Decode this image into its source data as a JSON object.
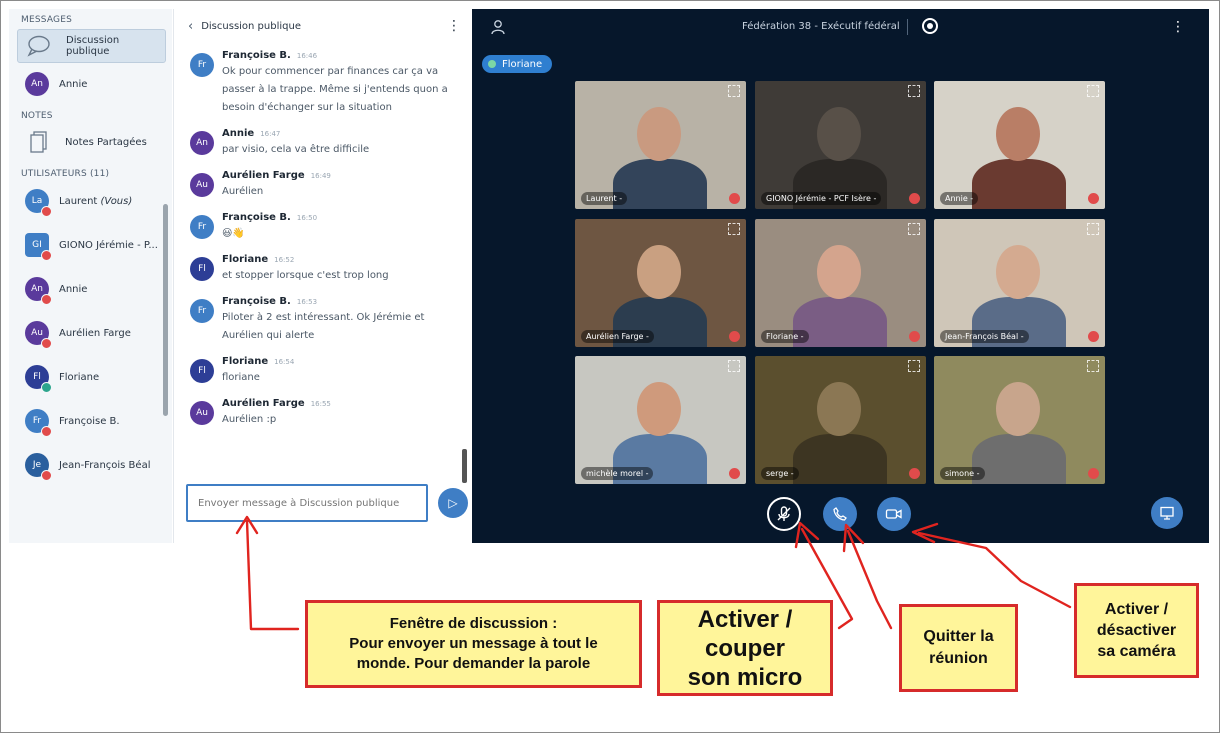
{
  "sidebar": {
    "messages_title": "MESSAGES",
    "public_chat": "Discussion publique",
    "private_chat": {
      "initials": "An",
      "name": "Annie",
      "color": "#5a3a9c"
    },
    "notes_title": "NOTES",
    "shared_notes": "Notes Partagées",
    "users_title": "UTILISATEURS (11)",
    "users": [
      {
        "initials": "La",
        "name": "Laurent",
        "suffix": "(Vous)",
        "color": "#3f7ec5",
        "mic": "muted",
        "shape": "round"
      },
      {
        "initials": "GI",
        "name": "GIONO Jérémie - P...",
        "suffix": "",
        "color": "#3f7ec5",
        "mic": "muted",
        "shape": "square"
      },
      {
        "initials": "An",
        "name": "Annie",
        "suffix": "",
        "color": "#5a3a9c",
        "mic": "muted",
        "shape": "round"
      },
      {
        "initials": "Au",
        "name": "Aurélien Farge",
        "suffix": "",
        "color": "#5a3a9c",
        "mic": "muted",
        "shape": "round"
      },
      {
        "initials": "Fl",
        "name": "Floriane",
        "suffix": "",
        "color": "#2d3e96",
        "mic": "on",
        "shape": "round"
      },
      {
        "initials": "Fr",
        "name": "Françoise B.",
        "suffix": "",
        "color": "#3f7ec5",
        "mic": "muted",
        "shape": "round"
      },
      {
        "initials": "Je",
        "name": "Jean-François Béal",
        "suffix": "",
        "color": "#2a5f9e",
        "mic": "muted",
        "shape": "round"
      }
    ]
  },
  "chat": {
    "title": "Discussion publique",
    "messages": [
      {
        "initials": "Fr",
        "color": "#3f7ec5",
        "author": "Françoise B.",
        "time": "16:46",
        "lines": [
          "Ok pour commencer par finances car ça va",
          "passer à la trappe. Même si j'entends quon a",
          "besoin d'échanger sur la situation"
        ]
      },
      {
        "initials": "An",
        "color": "#5a3a9c",
        "author": "Annie",
        "time": "16:47",
        "lines": [
          "par visio, cela va être difficile"
        ]
      },
      {
        "initials": "Au",
        "color": "#5a3a9c",
        "author": "Aurélien Farge",
        "time": "16:49",
        "lines": [
          "Aurélien"
        ]
      },
      {
        "initials": "Fr",
        "color": "#3f7ec5",
        "author": "Françoise B.",
        "time": "16:50",
        "lines": [
          "😃👋"
        ]
      },
      {
        "initials": "Fl",
        "color": "#2d3e96",
        "author": "Floriane",
        "time": "16:52",
        "lines": [
          "et stopper lorsque c'est trop long"
        ]
      },
      {
        "initials": "Fr",
        "color": "#3f7ec5",
        "author": "Françoise B.",
        "time": "16:53",
        "lines": [
          "Piloter à 2 est intéressant. Ok Jérémie et",
          "Aurélien qui alerte"
        ]
      },
      {
        "initials": "Fl",
        "color": "#2d3e96",
        "author": "Floriane",
        "time": "16:54",
        "lines": [
          "floriane"
        ]
      },
      {
        "initials": "Au",
        "color": "#5a3a9c",
        "author": "Aurélien Farge",
        "time": "16:55",
        "lines": [
          "Aurélien :p"
        ]
      }
    ],
    "input_placeholder": "Envoyer message à Discussion publique"
  },
  "meeting": {
    "title": "Fédération 38 - Exécutif fédéral",
    "talking": "Floriane",
    "tiles": [
      {
        "label": "Laurent -",
        "bg": "#b8b2a6",
        "skin": "#c99a80",
        "shirt": "#33445a"
      },
      {
        "label": "GIONO Jérémie - PCF Isère -",
        "bg": "#3f3b37",
        "skin": "#585048",
        "shirt": "#2b2825"
      },
      {
        "label": "Annie -",
        "bg": "#d6d2c8",
        "skin": "#b97e66",
        "shirt": "#6a3a30"
      },
      {
        "label": "Aurélien Farge -",
        "bg": "#6e5642",
        "skin": "#c9a081",
        "shirt": "#2c3d4f"
      },
      {
        "label": "Floriane -",
        "bg": "#9a8d80",
        "skin": "#d4a48d",
        "shirt": "#7a5d84"
      },
      {
        "label": "Jean-François Béal -",
        "bg": "#cfc6b8",
        "skin": "#d4aa90",
        "shirt": "#5a6c88"
      },
      {
        "label": "michèle morel -",
        "bg": "#c7c7c1",
        "skin": "#cf9a7c",
        "shirt": "#5a7aa2"
      },
      {
        "label": "serge -",
        "bg": "#5b4f2e",
        "skin": "#8b7754",
        "shirt": "#3d3522"
      },
      {
        "label": "simone -",
        "bg": "#8f8a5e",
        "skin": "#c8a58c",
        "shirt": "#6e6e6e"
      }
    ]
  },
  "annotations": {
    "chat": [
      "Fenêtre de discussion :",
      "Pour envoyer un message à tout le",
      "monde. Pour demander la parole"
    ],
    "mic": [
      "Activer /",
      "couper",
      "son micro"
    ],
    "quit": [
      "Quitter la",
      "réunion"
    ],
    "camera": [
      "Activer /",
      "désactiver",
      "sa caméra"
    ]
  },
  "colors": {
    "accent": "#3f7ec5",
    "video_bg": "#06172b",
    "callout_bg": "#fff59a",
    "callout_border": "#d62b2b",
    "muted": "#e14b4b"
  }
}
